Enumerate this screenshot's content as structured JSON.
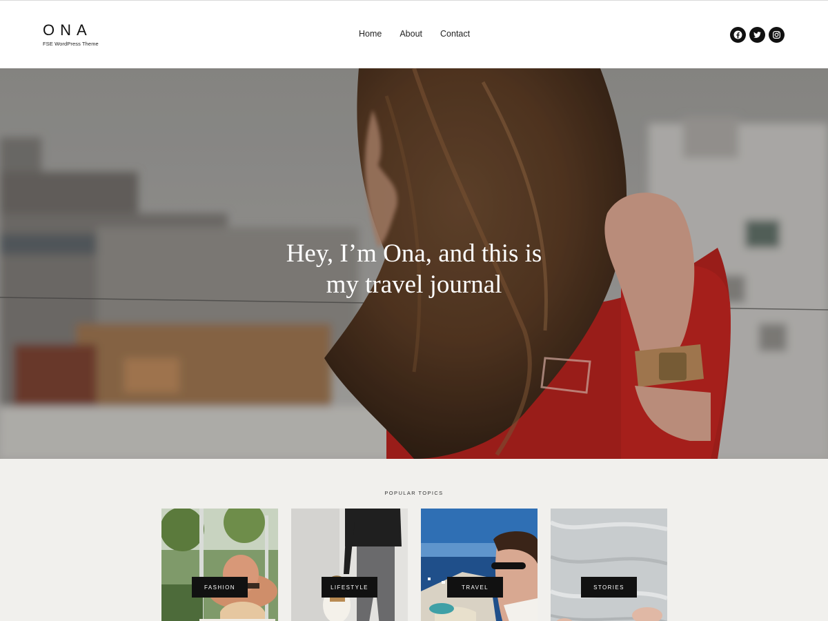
{
  "site": {
    "title": "ONA",
    "tagline": "FSE WordPress Theme"
  },
  "nav": {
    "items": [
      {
        "label": "Home"
      },
      {
        "label": "About"
      },
      {
        "label": "Contact"
      }
    ]
  },
  "social": {
    "icons": [
      "facebook-icon",
      "twitter-icon",
      "instagram-icon"
    ]
  },
  "hero": {
    "line1": "Hey, I’m Ona, and this is",
    "line2": "my travel journal"
  },
  "topics": {
    "heading": "POPULAR TOPICS",
    "items": [
      {
        "label": "FASHION"
      },
      {
        "label": "LIFESTYLE"
      },
      {
        "label": "TRAVEL"
      },
      {
        "label": "STORIES"
      }
    ]
  },
  "colors": {
    "header_bg": "#ffffff",
    "accent": "#111111",
    "topics_bg": "#f1f0ed",
    "hero_text": "#ffffff"
  }
}
